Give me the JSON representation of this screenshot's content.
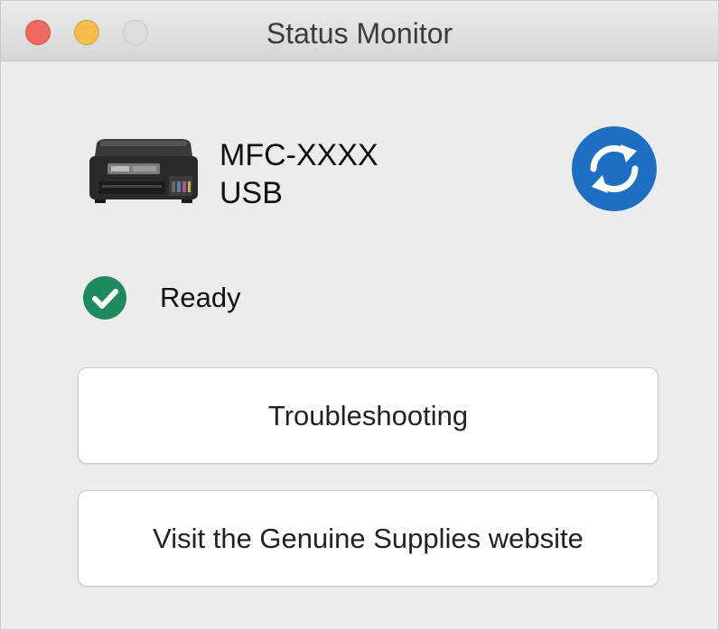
{
  "window": {
    "title": "Status Monitor",
    "traffic_lights": [
      "close",
      "minimize",
      "zoom"
    ]
  },
  "device": {
    "name": "MFC-XXXX",
    "connection": "USB",
    "icon": "printer-icon"
  },
  "refresh": {
    "icon": "refresh-icon",
    "color": "#1e6fc4"
  },
  "status": {
    "text": "Ready",
    "icon": "check-circle-icon",
    "color": "#1f8a5e"
  },
  "buttons": {
    "troubleshooting": "Troubleshooting",
    "supplies": "Visit the Genuine Supplies website"
  }
}
